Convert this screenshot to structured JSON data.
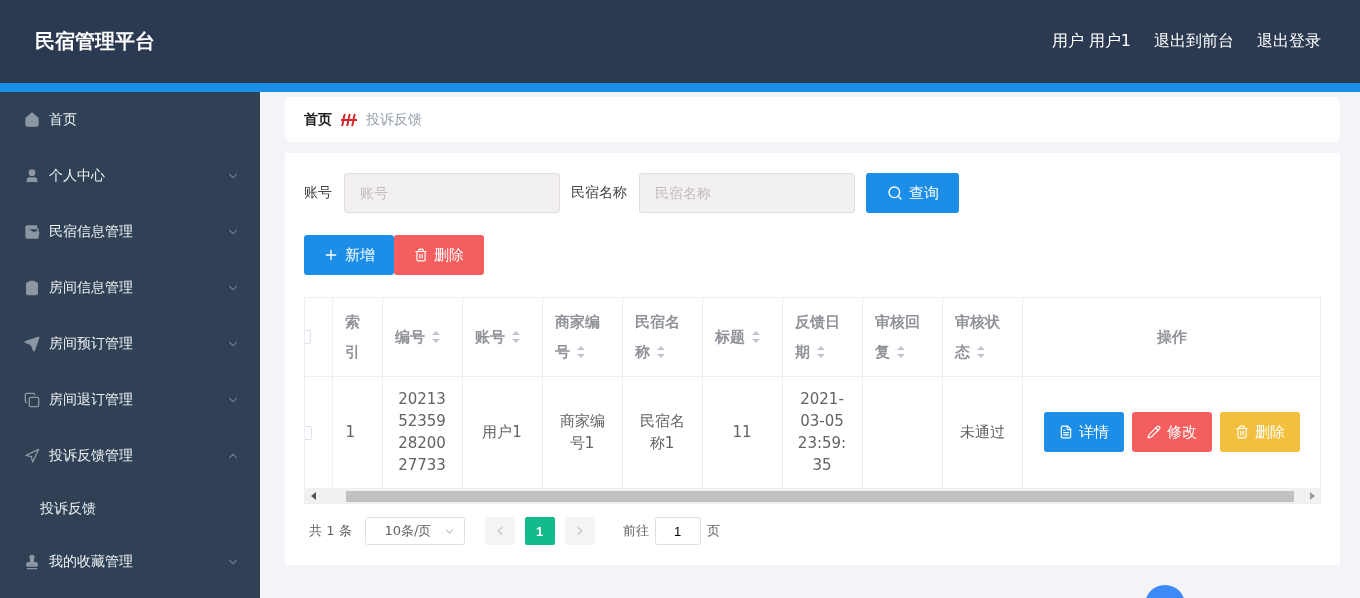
{
  "header": {
    "title": "民宿管理平台",
    "links": [
      "用户 用户1",
      "退出到前台",
      "退出登录"
    ]
  },
  "sidebar": {
    "items": [
      {
        "label": "首页",
        "expandable": false
      },
      {
        "label": "个人中心",
        "expandable": true,
        "expanded": false
      },
      {
        "label": "民宿信息管理",
        "expandable": true,
        "expanded": false
      },
      {
        "label": "房间信息管理",
        "expandable": true,
        "expanded": false
      },
      {
        "label": "房间预订管理",
        "expandable": true,
        "expanded": false
      },
      {
        "label": "房间退订管理",
        "expandable": true,
        "expanded": false
      },
      {
        "label": "投诉反馈管理",
        "expandable": true,
        "expanded": true,
        "children": [
          {
            "label": "投诉反馈"
          }
        ]
      },
      {
        "label": "我的收藏管理",
        "expandable": true,
        "expanded": false
      }
    ]
  },
  "breadcrumb": {
    "home": "首页",
    "current": "投诉反馈"
  },
  "search": {
    "fields": [
      {
        "label": "账号",
        "placeholder": "账号"
      },
      {
        "label": "民宿名称",
        "placeholder": "民宿名称"
      }
    ],
    "button": "查询"
  },
  "actions": [
    {
      "kind": "add",
      "label": "新增"
    },
    {
      "kind": "delete",
      "label": "删除"
    }
  ],
  "table": {
    "header_checked": false,
    "columns": [
      {
        "label": "索引",
        "sortable": false
      },
      {
        "label": "编号",
        "sortable": true
      },
      {
        "label": "账号",
        "sortable": true
      },
      {
        "label": "商家编号",
        "sortable": true
      },
      {
        "label": "民宿名称",
        "sortable": true
      },
      {
        "label": "标题",
        "sortable": true
      },
      {
        "label": "反馈日期",
        "sortable": true
      },
      {
        "label": "审核回复",
        "sortable": true
      },
      {
        "label": "审核状态",
        "sortable": true
      },
      {
        "label": "操作",
        "sortable": false
      }
    ],
    "rows": [
      {
        "checked": false,
        "cells": [
          "1",
          "20213523592820027733",
          "用户1",
          "商家编号1",
          "民宿名称1",
          "11",
          "2021-03-05 23:59:35",
          "",
          "未通过"
        ],
        "buttons": [
          {
            "kind": "detail",
            "label": "详情"
          },
          {
            "kind": "edit",
            "label": "修改"
          },
          {
            "kind": "delete",
            "label": "删除"
          }
        ]
      }
    ]
  },
  "pagination": {
    "total": "共 1 条",
    "page_size": "10条/页",
    "pages": [
      {
        "label": "1",
        "selected": true
      }
    ],
    "goto_label": "前往",
    "goto_value": "1",
    "goto_suffix": "页"
  }
}
